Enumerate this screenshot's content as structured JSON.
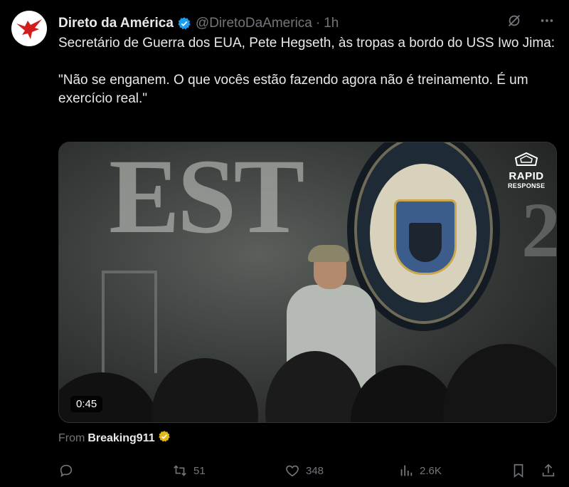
{
  "tweet": {
    "author_name": "Direto da América",
    "handle": "@DiretoDaAmerica",
    "dot": "·",
    "time": "1h",
    "text": "Secretário de Guerra dos EUA, Pete Hegseth, às tropas a bordo do USS Iwo Jima:\n\n\"Não se enganem. O que vocês estão fazendo agora não é treinamento. É um exercício real.\""
  },
  "media": {
    "duration": "0:45",
    "watermark_line1": "RAPID",
    "watermark_line2": "RESPONSE"
  },
  "source": {
    "label": "From",
    "name": "Breaking911"
  },
  "actions": {
    "reply_count": "",
    "retweet_count": "51",
    "like_count": "348",
    "views_count": "2.6K"
  },
  "colors": {
    "verified_blue": "#1d9bf0",
    "verified_gold": "#e2b719",
    "avatar_red": "#d11d1d"
  },
  "icons": [
    "reply-icon",
    "retweet-icon",
    "like-icon",
    "views-icon",
    "bookmark-icon",
    "share-icon",
    "grok-icon",
    "more-icon"
  ]
}
